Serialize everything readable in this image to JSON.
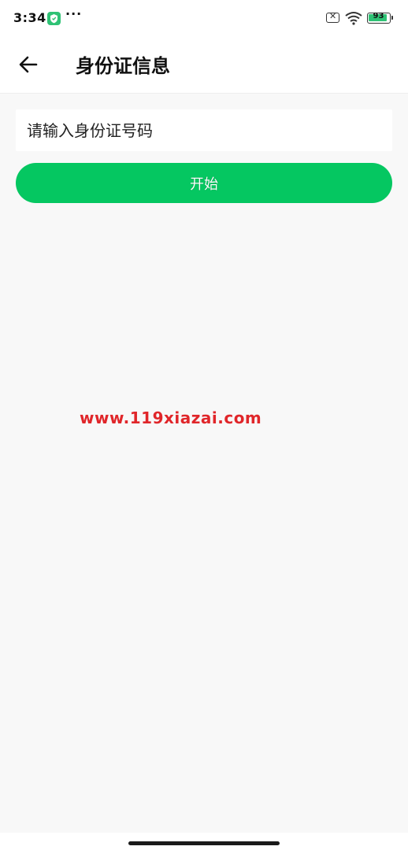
{
  "status_bar": {
    "time": "3:34",
    "more": "···",
    "battery_level": "93",
    "battery_fraction": 0.93
  },
  "header": {
    "back_icon": "arrow-left-icon",
    "title": "身份证信息"
  },
  "form": {
    "id_placeholder": "请输入身份证号码",
    "id_value": "",
    "start_label": "开始"
  },
  "watermark": {
    "text": "www.119xiazai.com"
  },
  "colors": {
    "accent": "#05c761",
    "watermark": "#e0262a",
    "background": "#f8f8f8"
  }
}
